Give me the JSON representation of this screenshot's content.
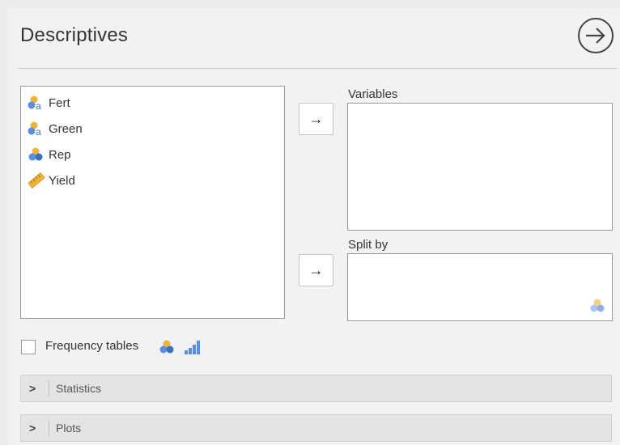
{
  "header": {
    "title": "Descriptives",
    "run_icon": "circle-arrow-right-icon"
  },
  "source_variables": [
    {
      "name": "Fert",
      "icon": "nominal-text-icon"
    },
    {
      "name": "Green",
      "icon": "nominal-text-icon"
    },
    {
      "name": "Rep",
      "icon": "nominal-icon"
    },
    {
      "name": "Yield",
      "icon": "continuous-ruler-icon"
    }
  ],
  "variables_box": {
    "label": "Variables",
    "move_button": "→"
  },
  "split_by_box": {
    "label": "Split by",
    "move_button": "→"
  },
  "frequency_tables": {
    "label": "Frequency tables",
    "checked": false
  },
  "sections": [
    {
      "label": "Statistics",
      "expanded": false
    },
    {
      "label": "Plots",
      "expanded": false
    }
  ],
  "colors": {
    "nominal_orange": "#f0b43c",
    "nominal_blue": "#5a8fe0",
    "ruler": "#f0b43c"
  }
}
